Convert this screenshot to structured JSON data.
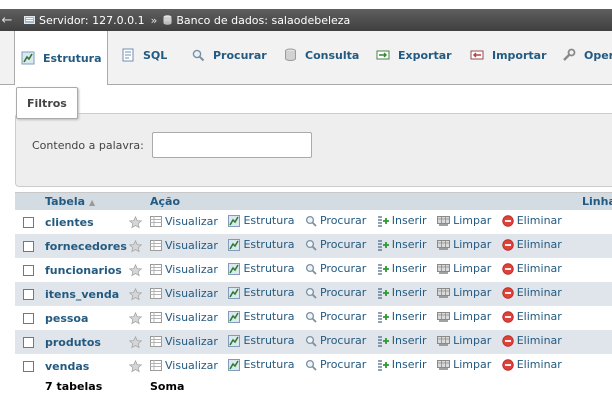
{
  "breadcrumb": {
    "server": "Servidor: 127.0.0.1",
    "separator": "»",
    "database": "Banco de dados: salaodebeleza"
  },
  "tabs": [
    {
      "label": "Estrutura",
      "icon": "structure-icon",
      "active": true
    },
    {
      "label": "SQL",
      "icon": "sql-icon",
      "active": false
    },
    {
      "label": "Procurar",
      "icon": "search-icon",
      "active": false
    },
    {
      "label": "Consulta",
      "icon": "query-icon",
      "active": false
    },
    {
      "label": "Exportar",
      "icon": "export-icon",
      "active": false
    },
    {
      "label": "Importar",
      "icon": "import-icon",
      "active": false
    },
    {
      "label": "Opera",
      "icon": "wrench-icon",
      "active": false
    }
  ],
  "filters": {
    "legend": "Filtros",
    "label": "Contendo a palavra:",
    "value": ""
  },
  "table": {
    "headers": {
      "table": "Tabela",
      "sort_indicator": "▲",
      "action": "Ação",
      "rows": "Linha"
    },
    "actions": {
      "browse": "Visualizar",
      "structure": "Estrutura",
      "search": "Procurar",
      "insert": "Inserir",
      "empty": "Limpar",
      "drop": "Eliminar"
    },
    "rows": [
      {
        "name": "clientes"
      },
      {
        "name": "fornecedores"
      },
      {
        "name": "funcionarios"
      },
      {
        "name": "itens_venda"
      },
      {
        "name": "pessoa"
      },
      {
        "name": "produtos"
      },
      {
        "name": "vendas"
      }
    ],
    "footer": {
      "count": "7 tabelas",
      "sum": "Soma"
    }
  },
  "colors": {
    "link": "#235a81",
    "header_bg": "#d3dce3",
    "row_alt_bg": "#dfe5ea",
    "breadcrumb_bg": "#4a4a4a",
    "drop_red": "#e0413a"
  }
}
